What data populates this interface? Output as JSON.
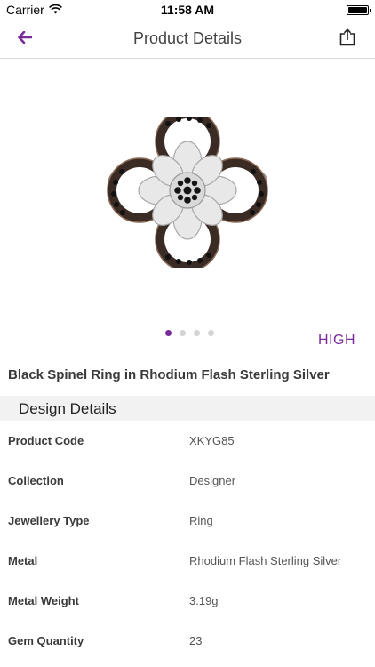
{
  "status_bar": {
    "carrier": "Carrier",
    "time": "11:58 AM"
  },
  "nav": {
    "title": "Product Details",
    "back_icon": "arrow-left-icon",
    "share_icon": "share-icon"
  },
  "colors": {
    "accent": "#7b2a9c",
    "section_bg": "#f2f2f2"
  },
  "pager": {
    "count": 4,
    "active_index": 0
  },
  "badge": "HIGH",
  "product": {
    "title": "Black Spinel Ring in Rhodium Flash Sterling Silver"
  },
  "section": {
    "title": "Design Details"
  },
  "details": [
    {
      "label": "Product Code",
      "value": "XKYG85"
    },
    {
      "label": "Collection",
      "value": "Designer"
    },
    {
      "label": "Jewellery Type",
      "value": "Ring"
    },
    {
      "label": "Metal",
      "value": "Rhodium Flash Sterling Silver"
    },
    {
      "label": "Metal Weight",
      "value": "3.19g"
    },
    {
      "label": "Gem Quantity",
      "value": "23"
    }
  ]
}
